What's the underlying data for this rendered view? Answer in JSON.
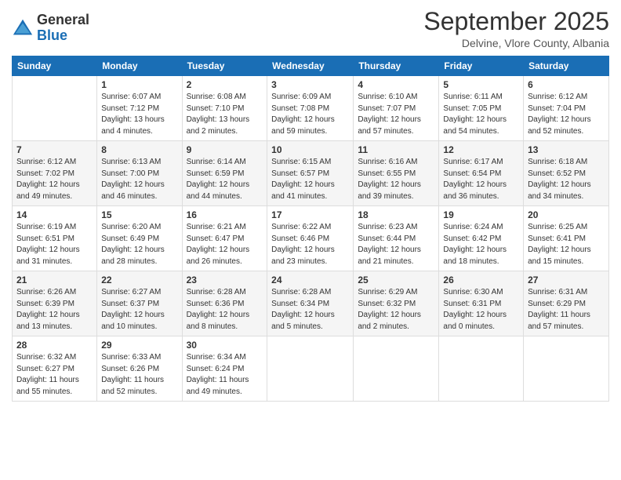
{
  "logo": {
    "general": "General",
    "blue": "Blue"
  },
  "header": {
    "month": "September 2025",
    "location": "Delvine, Vlore County, Albania"
  },
  "days_of_week": [
    "Sunday",
    "Monday",
    "Tuesday",
    "Wednesday",
    "Thursday",
    "Friday",
    "Saturday"
  ],
  "weeks": [
    [
      {
        "day": "",
        "detail": ""
      },
      {
        "day": "1",
        "detail": "Sunrise: 6:07 AM\nSunset: 7:12 PM\nDaylight: 13 hours\nand 4 minutes."
      },
      {
        "day": "2",
        "detail": "Sunrise: 6:08 AM\nSunset: 7:10 PM\nDaylight: 13 hours\nand 2 minutes."
      },
      {
        "day": "3",
        "detail": "Sunrise: 6:09 AM\nSunset: 7:08 PM\nDaylight: 12 hours\nand 59 minutes."
      },
      {
        "day": "4",
        "detail": "Sunrise: 6:10 AM\nSunset: 7:07 PM\nDaylight: 12 hours\nand 57 minutes."
      },
      {
        "day": "5",
        "detail": "Sunrise: 6:11 AM\nSunset: 7:05 PM\nDaylight: 12 hours\nand 54 minutes."
      },
      {
        "day": "6",
        "detail": "Sunrise: 6:12 AM\nSunset: 7:04 PM\nDaylight: 12 hours\nand 52 minutes."
      }
    ],
    [
      {
        "day": "7",
        "detail": "Sunrise: 6:12 AM\nSunset: 7:02 PM\nDaylight: 12 hours\nand 49 minutes."
      },
      {
        "day": "8",
        "detail": "Sunrise: 6:13 AM\nSunset: 7:00 PM\nDaylight: 12 hours\nand 46 minutes."
      },
      {
        "day": "9",
        "detail": "Sunrise: 6:14 AM\nSunset: 6:59 PM\nDaylight: 12 hours\nand 44 minutes."
      },
      {
        "day": "10",
        "detail": "Sunrise: 6:15 AM\nSunset: 6:57 PM\nDaylight: 12 hours\nand 41 minutes."
      },
      {
        "day": "11",
        "detail": "Sunrise: 6:16 AM\nSunset: 6:55 PM\nDaylight: 12 hours\nand 39 minutes."
      },
      {
        "day": "12",
        "detail": "Sunrise: 6:17 AM\nSunset: 6:54 PM\nDaylight: 12 hours\nand 36 minutes."
      },
      {
        "day": "13",
        "detail": "Sunrise: 6:18 AM\nSunset: 6:52 PM\nDaylight: 12 hours\nand 34 minutes."
      }
    ],
    [
      {
        "day": "14",
        "detail": "Sunrise: 6:19 AM\nSunset: 6:51 PM\nDaylight: 12 hours\nand 31 minutes."
      },
      {
        "day": "15",
        "detail": "Sunrise: 6:20 AM\nSunset: 6:49 PM\nDaylight: 12 hours\nand 28 minutes."
      },
      {
        "day": "16",
        "detail": "Sunrise: 6:21 AM\nSunset: 6:47 PM\nDaylight: 12 hours\nand 26 minutes."
      },
      {
        "day": "17",
        "detail": "Sunrise: 6:22 AM\nSunset: 6:46 PM\nDaylight: 12 hours\nand 23 minutes."
      },
      {
        "day": "18",
        "detail": "Sunrise: 6:23 AM\nSunset: 6:44 PM\nDaylight: 12 hours\nand 21 minutes."
      },
      {
        "day": "19",
        "detail": "Sunrise: 6:24 AM\nSunset: 6:42 PM\nDaylight: 12 hours\nand 18 minutes."
      },
      {
        "day": "20",
        "detail": "Sunrise: 6:25 AM\nSunset: 6:41 PM\nDaylight: 12 hours\nand 15 minutes."
      }
    ],
    [
      {
        "day": "21",
        "detail": "Sunrise: 6:26 AM\nSunset: 6:39 PM\nDaylight: 12 hours\nand 13 minutes."
      },
      {
        "day": "22",
        "detail": "Sunrise: 6:27 AM\nSunset: 6:37 PM\nDaylight: 12 hours\nand 10 minutes."
      },
      {
        "day": "23",
        "detail": "Sunrise: 6:28 AM\nSunset: 6:36 PM\nDaylight: 12 hours\nand 8 minutes."
      },
      {
        "day": "24",
        "detail": "Sunrise: 6:28 AM\nSunset: 6:34 PM\nDaylight: 12 hours\nand 5 minutes."
      },
      {
        "day": "25",
        "detail": "Sunrise: 6:29 AM\nSunset: 6:32 PM\nDaylight: 12 hours\nand 2 minutes."
      },
      {
        "day": "26",
        "detail": "Sunrise: 6:30 AM\nSunset: 6:31 PM\nDaylight: 12 hours\nand 0 minutes."
      },
      {
        "day": "27",
        "detail": "Sunrise: 6:31 AM\nSunset: 6:29 PM\nDaylight: 11 hours\nand 57 minutes."
      }
    ],
    [
      {
        "day": "28",
        "detail": "Sunrise: 6:32 AM\nSunset: 6:27 PM\nDaylight: 11 hours\nand 55 minutes."
      },
      {
        "day": "29",
        "detail": "Sunrise: 6:33 AM\nSunset: 6:26 PM\nDaylight: 11 hours\nand 52 minutes."
      },
      {
        "day": "30",
        "detail": "Sunrise: 6:34 AM\nSunset: 6:24 PM\nDaylight: 11 hours\nand 49 minutes."
      },
      {
        "day": "",
        "detail": ""
      },
      {
        "day": "",
        "detail": ""
      },
      {
        "day": "",
        "detail": ""
      },
      {
        "day": "",
        "detail": ""
      }
    ]
  ]
}
